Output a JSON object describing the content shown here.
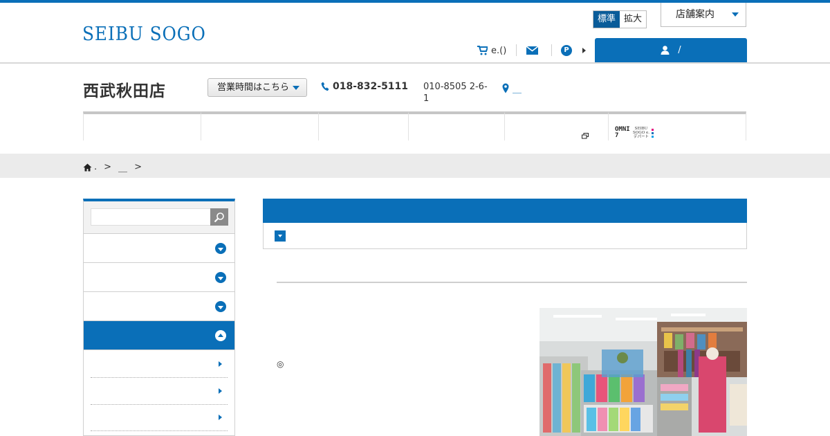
{
  "header": {
    "logo_text": "SEIBU SOGO",
    "font_size": {
      "standard": "標準",
      "large": "拡大"
    },
    "store_guide": "店舗案内",
    "cart_label": "e.()",
    "point_label": "P",
    "login_label": "/"
  },
  "store": {
    "name": "西武秋田店",
    "hours_button": "営業時間はこちら",
    "tel": "018-832-5111",
    "address": "010-8505 2-6-1",
    "map_label": "＿"
  },
  "nav": {
    "omni_text": "OMNI7",
    "omni_sub": "SEIBU SOGO e.デパート"
  },
  "breadcrumb": {
    "home_label": ".",
    "separator": ">",
    "item": "＿"
  },
  "sidebar": {
    "search_placeholder": "",
    "menu_count": 4,
    "active_index": 3
  },
  "main": {
    "note_mark": "◎"
  },
  "colors": {
    "brand": "#0a6fb8",
    "brand_dark": "#0a5c99",
    "breadcrumb_bg": "#ebebeb"
  },
  "icons": [
    "cart-icon",
    "mail-icon",
    "point-icon",
    "user-icon",
    "phone-icon",
    "map-pin-icon",
    "home-icon",
    "search-icon",
    "external-window-icon",
    "chevron-down-icon",
    "chevron-up-icon",
    "chevron-right-icon"
  ]
}
